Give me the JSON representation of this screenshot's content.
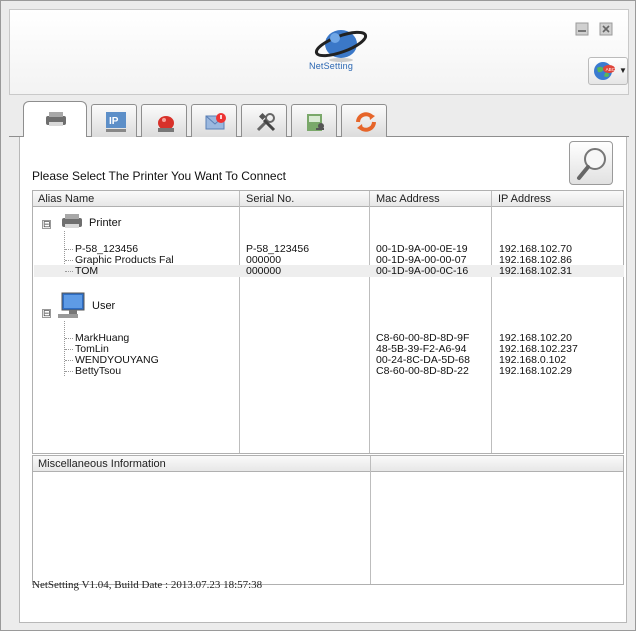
{
  "app": {
    "logo_text": "NetSetting",
    "footer": "NetSetting V1.04, Build Date : 2013.07.23 18:57:38"
  },
  "header": {
    "minimize_icon": "minimize-icon",
    "close_icon": "close-icon",
    "language_icon": "globe-abc-icon"
  },
  "tabs": [
    {
      "icon": "printer-icon",
      "active": true
    },
    {
      "icon": "ip-network-icon",
      "active": false
    },
    {
      "icon": "alarm-siren-icon",
      "active": false
    },
    {
      "icon": "email-alert-icon",
      "active": false
    },
    {
      "icon": "tools-icon",
      "active": false
    },
    {
      "icon": "key-config-icon",
      "active": false
    },
    {
      "icon": "refresh-arrows-icon",
      "active": false
    }
  ],
  "main": {
    "prompt": "Please Select The Printer You Want To Connect",
    "columns": [
      "Alias Name",
      "Serial No.",
      "Mac Address",
      "IP Address"
    ],
    "groups": [
      {
        "label": "Printer",
        "expander": "⊟",
        "items": [
          {
            "alias": "P-58_123456",
            "serial": "P-58_123456",
            "mac": "00-1D-9A-00-0E-19",
            "ip": "192.168.102.70",
            "selected": false
          },
          {
            "alias": "Graphic Products Fal",
            "serial": "000000",
            "mac": "00-1D-9A-00-00-07",
            "ip": "192.168.102.86",
            "selected": false
          },
          {
            "alias": "TOM",
            "serial": "000000",
            "mac": "00-1D-9A-00-0C-16",
            "ip": "192.168.102.31",
            "selected": true
          }
        ]
      },
      {
        "label": "User",
        "expander": "⊟",
        "items": [
          {
            "alias": "MarkHuang",
            "serial": "",
            "mac": "C8-60-00-8D-8D-9F",
            "ip": "192.168.102.20",
            "selected": false
          },
          {
            "alias": "TomLin",
            "serial": "",
            "mac": "48-5B-39-F2-A6-94",
            "ip": "192.168.102.237",
            "selected": false
          },
          {
            "alias": "WENDYOUYANG",
            "serial": "",
            "mac": "00-24-8C-DA-5D-68",
            "ip": "192.168.0.102",
            "selected": false
          },
          {
            "alias": "BettyTsou",
            "serial": "",
            "mac": "C8-60-00-8D-8D-22",
            "ip": "192.168.102.29",
            "selected": false
          }
        ]
      }
    ],
    "misc_header": "Miscellaneous Information"
  },
  "colors": {
    "accent": "#2b67b2",
    "selected_row": "#eeeeee"
  }
}
